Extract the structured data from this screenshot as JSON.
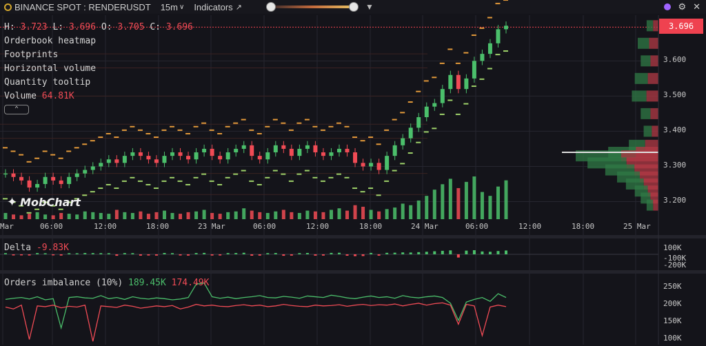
{
  "topbar": {
    "symbol": "BINANCE SPOT : RENDERUSDT",
    "timeframe": "15m",
    "indicators_label": "Indicators",
    "slider_range": [
      0,
      1
    ]
  },
  "legend": {
    "h_label": "H:",
    "h_value": "3.723",
    "l_label": "L:",
    "l_value": "3.696",
    "o_label": "O:",
    "o_value": "3.705",
    "c_label": "C:",
    "c_value": "3.696",
    "rows": [
      "Orderbook heatmap",
      "Footprints",
      "Horizontal volume",
      "Quantity tooltip"
    ],
    "volume_label": "Volume",
    "volume_value": "64.81K"
  },
  "logo_text": "MobChart",
  "last_price": "3.696",
  "colors": {
    "up": "#4bbf6b",
    "down": "#f14b55",
    "ask": "#e49a3a",
    "bid": "#9fd36a",
    "bg": "#14141a",
    "grid": "#262630"
  },
  "chart_data": [
    {
      "type": "candlestick",
      "title": "",
      "y_ticks": [
        "3.600",
        "3.500",
        "3.400",
        "3.300",
        "3.200"
      ],
      "x_ticks": [
        "Mar",
        "06:00",
        "12:00",
        "18:00",
        "23 Mar",
        "06:00",
        "12:00",
        "18:00",
        "24 Mar",
        "06:00",
        "12:00",
        "18:00",
        "25 Mar"
      ],
      "ylim": [
        3.15,
        3.73
      ],
      "close_series": [
        3.28,
        3.27,
        3.26,
        3.24,
        3.25,
        3.27,
        3.26,
        3.25,
        3.27,
        3.28,
        3.29,
        3.3,
        3.31,
        3.32,
        3.31,
        3.33,
        3.34,
        3.33,
        3.32,
        3.31,
        3.33,
        3.34,
        3.33,
        3.32,
        3.34,
        3.35,
        3.33,
        3.32,
        3.34,
        3.35,
        3.36,
        3.33,
        3.32,
        3.34,
        3.36,
        3.35,
        3.33,
        3.35,
        3.36,
        3.34,
        3.33,
        3.34,
        3.35,
        3.34,
        3.31,
        3.3,
        3.31,
        3.29,
        3.33,
        3.36,
        3.38,
        3.41,
        3.44,
        3.47,
        3.48,
        3.52,
        3.56,
        3.52,
        3.55,
        3.6,
        3.62,
        3.65,
        3.69,
        3.7
      ],
      "volume_series": [
        8,
        6,
        5,
        7,
        9,
        6,
        5,
        8,
        7,
        6,
        10,
        9,
        8,
        7,
        12,
        9,
        8,
        10,
        7,
        9,
        11,
        8,
        7,
        9,
        10,
        12,
        8,
        7,
        9,
        10,
        14,
        11,
        9,
        8,
        10,
        12,
        9,
        8,
        11,
        10,
        9,
        12,
        14,
        11,
        18,
        16,
        12,
        10,
        13,
        15,
        20,
        18,
        24,
        30,
        38,
        45,
        52,
        40,
        48,
        55,
        35,
        30,
        42,
        50
      ],
      "horizontal_volume_levels": [
        3.7,
        3.65,
        3.6,
        3.55,
        3.5,
        3.45,
        3.4,
        3.36,
        3.34,
        3.33,
        3.31,
        3.29,
        3.27,
        3.25,
        3.23,
        3.21,
        3.19
      ],
      "horizontal_volume_values": [
        20,
        35,
        30,
        40,
        45,
        30,
        25,
        50,
        85,
        140,
        120,
        90,
        70,
        55,
        40,
        30,
        20
      ]
    },
    {
      "type": "bar",
      "title": "Delta",
      "value_label": "-9.83K",
      "y_ticks": [
        "100K",
        "-100K",
        "-200K"
      ]
    },
    {
      "type": "line",
      "title": "Orders imbalance (10%)",
      "series": [
        {
          "name": "",
          "label_value": "189.45K"
        },
        {
          "name": "",
          "label_value": "174.49K"
        }
      ],
      "y_ticks": [
        "250K",
        "200K",
        "150K",
        "100K"
      ],
      "ylim": [
        90,
        260
      ],
      "series_values": [
        [
          205,
          208,
          210,
          206,
          212,
          204,
          207,
          130,
          210,
          212,
          209,
          208,
          215,
          207,
          210,
          205,
          212,
          208,
          206,
          209,
          207,
          204,
          206,
          210,
          245,
          248,
          212,
          208,
          211,
          207,
          210,
          212,
          215,
          210,
          209,
          213,
          211,
          208,
          214,
          212,
          210,
          216,
          213,
          209,
          207,
          211,
          214,
          210,
          212,
          208,
          215,
          211,
          209,
          212,
          214,
          210,
          195,
          150,
          198,
          205,
          210,
          200,
          220,
          210
        ],
        [
          185,
          180,
          190,
          100,
          188,
          186,
          190,
          183,
          187,
          185,
          190,
          95,
          188,
          186,
          184,
          190,
          187,
          182,
          185,
          188,
          186,
          189,
          180,
          185,
          192,
          188,
          190,
          187,
          186,
          189,
          191,
          188,
          190,
          186,
          188,
          192,
          189,
          187,
          186,
          190,
          188,
          189,
          191,
          187,
          190,
          192,
          189,
          191,
          190,
          193,
          188,
          192,
          195,
          190,
          194,
          196,
          190,
          140,
          192,
          188,
          110,
          185,
          190,
          186
        ]
      ]
    }
  ]
}
